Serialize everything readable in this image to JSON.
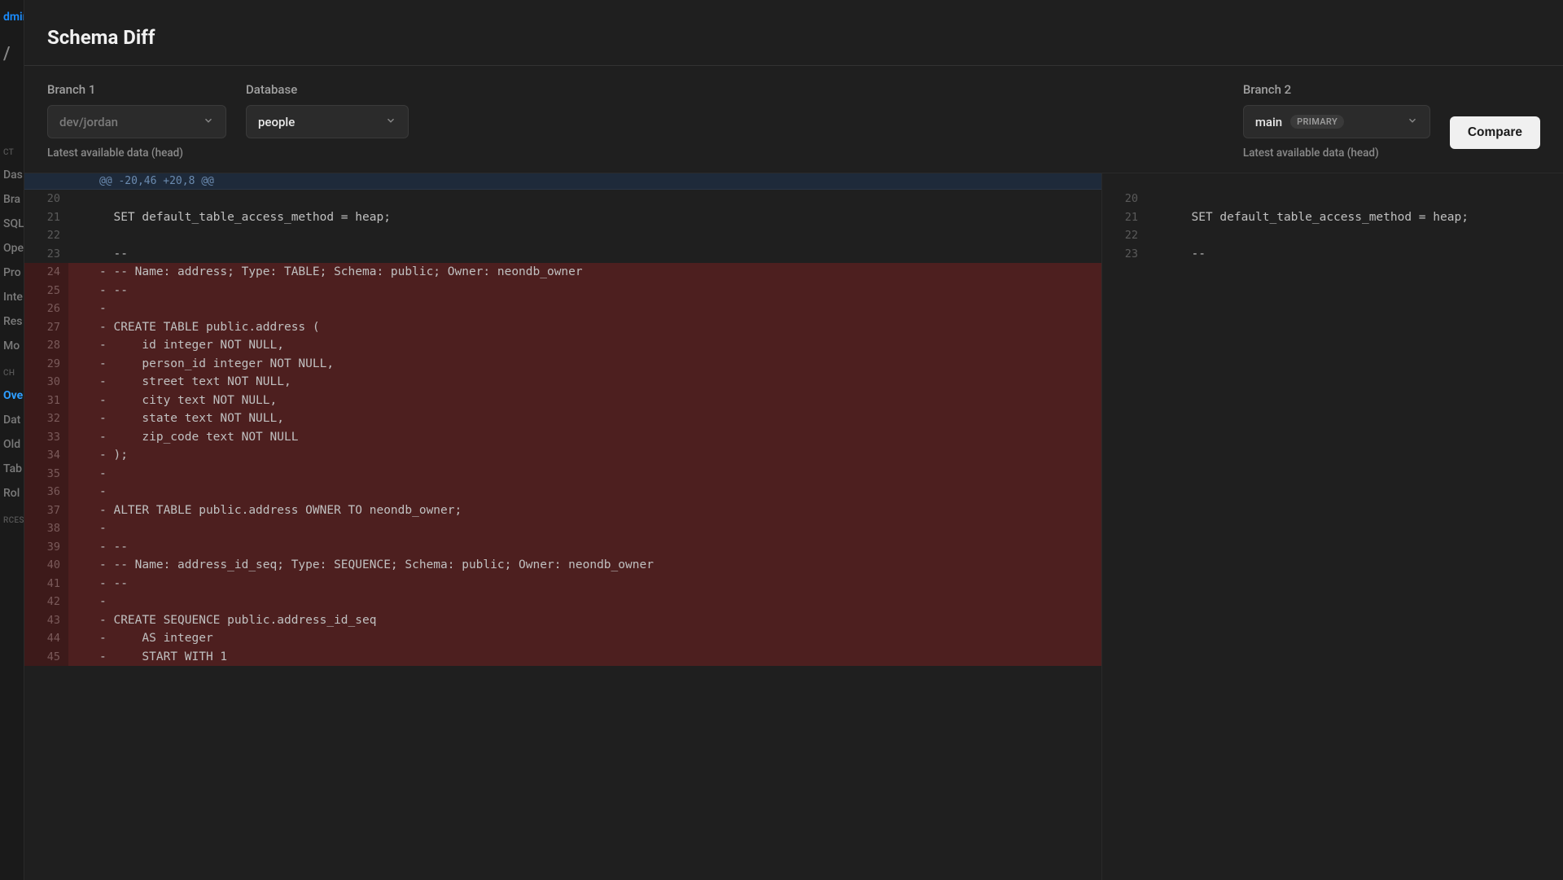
{
  "sidebar_fragments": {
    "item0": "dmir",
    "item1": "/",
    "section1_label": "CT",
    "items_a": [
      "Das",
      "Bra",
      "SQL",
      "Ope",
      "Pro",
      "Inte",
      "Res",
      "Mo"
    ],
    "section2_label": "CH",
    "items_b": [
      "Ove",
      "Dat",
      "Old",
      "Tab",
      "Rol"
    ],
    "section3_label": "RCES"
  },
  "modal": {
    "title": "Schema Diff",
    "branch1": {
      "label": "Branch 1",
      "value": "dev/jordan",
      "helper": "Latest available data (head)"
    },
    "database": {
      "label": "Database",
      "value": "people"
    },
    "branch2": {
      "label": "Branch 2",
      "value": "main",
      "badge": "PRIMARY",
      "helper": "Latest available data (head)"
    },
    "compare_label": "Compare"
  },
  "diff": {
    "hunk_header": "@@ -20,46 +20,8 @@",
    "left": [
      {
        "n": 20,
        "t": "ctx",
        "c": ""
      },
      {
        "n": 21,
        "t": "ctx",
        "c": "  SET default_table_access_method = heap;"
      },
      {
        "n": 22,
        "t": "ctx",
        "c": ""
      },
      {
        "n": 23,
        "t": "ctx",
        "c": "  --"
      },
      {
        "n": 24,
        "t": "del",
        "c": "- -- Name: address; Type: TABLE; Schema: public; Owner: neondb_owner"
      },
      {
        "n": 25,
        "t": "del",
        "c": "- --"
      },
      {
        "n": 26,
        "t": "del",
        "c": "- "
      },
      {
        "n": 27,
        "t": "del",
        "c": "- CREATE TABLE public.address ("
      },
      {
        "n": 28,
        "t": "del",
        "c": "-     id integer NOT NULL,"
      },
      {
        "n": 29,
        "t": "del",
        "c": "-     person_id integer NOT NULL,"
      },
      {
        "n": 30,
        "t": "del",
        "c": "-     street text NOT NULL,"
      },
      {
        "n": 31,
        "t": "del",
        "c": "-     city text NOT NULL,"
      },
      {
        "n": 32,
        "t": "del",
        "c": "-     state text NOT NULL,"
      },
      {
        "n": 33,
        "t": "del",
        "c": "-     zip_code text NOT NULL"
      },
      {
        "n": 34,
        "t": "del",
        "c": "- );"
      },
      {
        "n": 35,
        "t": "del",
        "c": "- "
      },
      {
        "n": 36,
        "t": "del",
        "c": "- "
      },
      {
        "n": 37,
        "t": "del",
        "c": "- ALTER TABLE public.address OWNER TO neondb_owner;"
      },
      {
        "n": 38,
        "t": "del",
        "c": "- "
      },
      {
        "n": 39,
        "t": "del",
        "c": "- --"
      },
      {
        "n": 40,
        "t": "del",
        "c": "- -- Name: address_id_seq; Type: SEQUENCE; Schema: public; Owner: neondb_owner"
      },
      {
        "n": 41,
        "t": "del",
        "c": "- --"
      },
      {
        "n": 42,
        "t": "del",
        "c": "- "
      },
      {
        "n": 43,
        "t": "del",
        "c": "- CREATE SEQUENCE public.address_id_seq"
      },
      {
        "n": 44,
        "t": "del",
        "c": "-     AS integer"
      },
      {
        "n": 45,
        "t": "del",
        "c": "-     START WITH 1"
      }
    ],
    "right": [
      {
        "n": 20,
        "t": "ctx",
        "c": ""
      },
      {
        "n": 21,
        "t": "ctx",
        "c": "  SET default_table_access_method = heap;"
      },
      {
        "n": 22,
        "t": "ctx",
        "c": ""
      },
      {
        "n": 23,
        "t": "ctx",
        "c": "  --"
      }
    ]
  }
}
